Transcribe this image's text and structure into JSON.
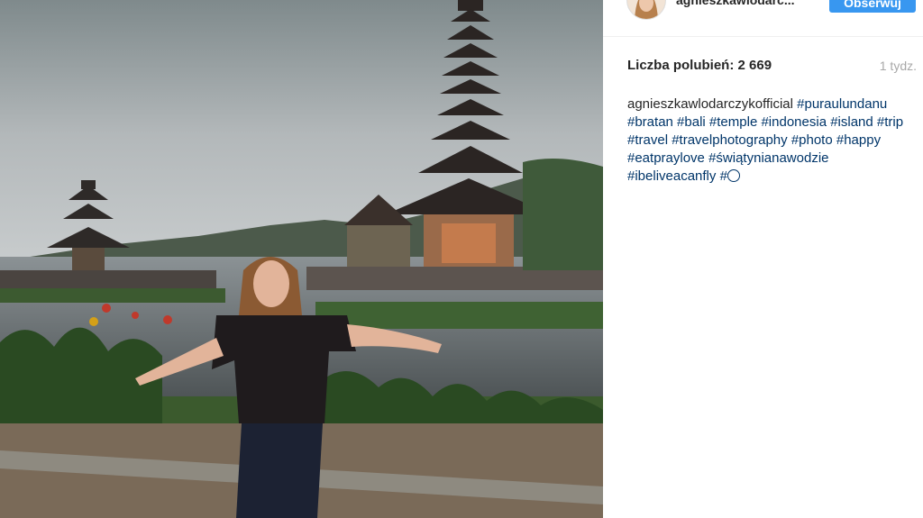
{
  "post": {
    "username": "agnieszkawlodarc...",
    "follow_label": "Obserwuj",
    "likes_text": "Liczba polubień: 2 669",
    "time_ago": "1 tydz.",
    "caption": {
      "author": "agnieszkawlodarczykofficial",
      "hashtags": [
        "#puraulundanu",
        "#bratan",
        "#bali",
        "#temple",
        "#indonesia",
        "#island",
        "#trip",
        "#travel",
        "#travelphotography",
        "#photo",
        "#happy",
        "#eatpraylove",
        "#świątynianawodzie",
        "#ibeliveacanfly",
        "#"
      ]
    }
  },
  "photo": {
    "icon": "photo-temple-lake",
    "colors": {
      "sky": "#9aa1a4",
      "water": "#5f6466",
      "foliage": "#2f4a2a"
    }
  },
  "colors": {
    "accent": "#3897f0",
    "hashtag": "#003569",
    "muted": "#a8a8a8"
  }
}
